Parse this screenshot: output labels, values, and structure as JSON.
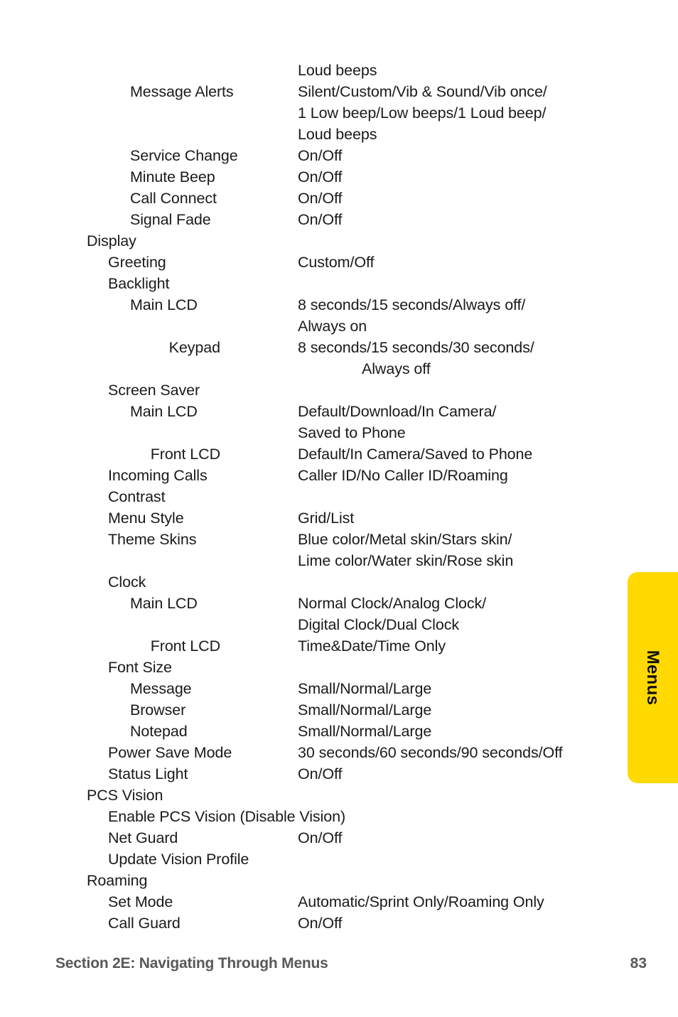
{
  "page": {
    "number": "83",
    "section_title": "Section 2E: Navigating Through Menus"
  },
  "side_tab": {
    "label": "Menus",
    "color": "#ffd900"
  },
  "menu_rows": [
    {
      "label": "",
      "level": 2,
      "values": [
        "Loud beeps"
      ]
    },
    {
      "label": "Message Alerts",
      "level": 2,
      "values": [
        "Silent/Custom/Vib & Sound/Vib once/",
        "1 Low beep/Low beeps/1 Loud beep/",
        "Loud beeps"
      ]
    },
    {
      "label": "Service Change",
      "level": 2,
      "values": [
        "On/Off"
      ]
    },
    {
      "label": "Minute Beep",
      "level": 2,
      "values": [
        "On/Off"
      ]
    },
    {
      "label": "Call Connect",
      "level": 2,
      "values": [
        "On/Off"
      ]
    },
    {
      "label": "Signal Fade",
      "level": 2,
      "values": [
        "On/Off"
      ]
    },
    {
      "label": "Display",
      "level": 0,
      "values": []
    },
    {
      "label": "Greeting",
      "level": 1,
      "values": [
        "Custom/Off"
      ]
    },
    {
      "label": "Backlight",
      "level": 1,
      "values": []
    },
    {
      "label": "Main LCD",
      "level": 2,
      "values": [
        "8 seconds/15 seconds/Always off/",
        "Always on"
      ]
    },
    {
      "label": "Keypad",
      "level": "2r",
      "values": [
        "8 seconds/15 seconds/30 seconds/",
        "Always off"
      ],
      "value_indents": [
        false,
        true
      ]
    },
    {
      "label": "Screen Saver",
      "level": 1,
      "values": []
    },
    {
      "label": "Main LCD",
      "level": 2,
      "values": [
        "Default/Download/In Camera/",
        "Saved to Phone"
      ]
    },
    {
      "label": "Front LCD",
      "level": "2r",
      "values": [
        "Default/In Camera/Saved to Phone"
      ]
    },
    {
      "label": "Incoming Calls",
      "level": 1,
      "values": [
        "Caller ID/No Caller ID/Roaming"
      ]
    },
    {
      "label": "Contrast",
      "level": 1,
      "values": []
    },
    {
      "label": "Menu Style",
      "level": 1,
      "values": [
        "Grid/List"
      ]
    },
    {
      "label": "Theme Skins",
      "level": 1,
      "values": [
        "Blue color/Metal skin/Stars skin/",
        "Lime color/Water skin/Rose skin"
      ]
    },
    {
      "label": "Clock",
      "level": 1,
      "values": []
    },
    {
      "label": "Main LCD",
      "level": 2,
      "values": [
        "Normal Clock/Analog Clock/",
        "Digital Clock/Dual Clock"
      ]
    },
    {
      "label": "Front LCD",
      "level": "2r",
      "values": [
        "Time&Date/Time Only"
      ]
    },
    {
      "label": "Font Size",
      "level": 1,
      "values": []
    },
    {
      "label": "Message",
      "level": 2,
      "values": [
        "Small/Normal/Large"
      ]
    },
    {
      "label": "Browser",
      "level": 2,
      "values": [
        "Small/Normal/Large"
      ]
    },
    {
      "label": "Notepad",
      "level": 2,
      "values": [
        "Small/Normal/Large"
      ]
    },
    {
      "label": "Power Save Mode",
      "level": 1,
      "values": [
        "30 seconds/60 seconds/90 seconds/Off"
      ]
    },
    {
      "label": "Status Light",
      "level": 1,
      "values": [
        "On/Off"
      ]
    },
    {
      "label": "PCS Vision",
      "level": 0,
      "values": []
    },
    {
      "label": "Enable PCS Vision (Disable Vision)",
      "level": 1,
      "values": []
    },
    {
      "label": "Net Guard",
      "level": 1,
      "values": [
        "On/Off"
      ]
    },
    {
      "label": "Update Vision Profile",
      "level": 1,
      "values": []
    },
    {
      "label": "Roaming",
      "level": 0,
      "values": []
    },
    {
      "label": "Set Mode",
      "level": 1,
      "values": [
        "Automatic/Sprint Only/Roaming Only"
      ]
    },
    {
      "label": "Call Guard",
      "level": 1,
      "values": [
        "On/Off"
      ]
    }
  ]
}
